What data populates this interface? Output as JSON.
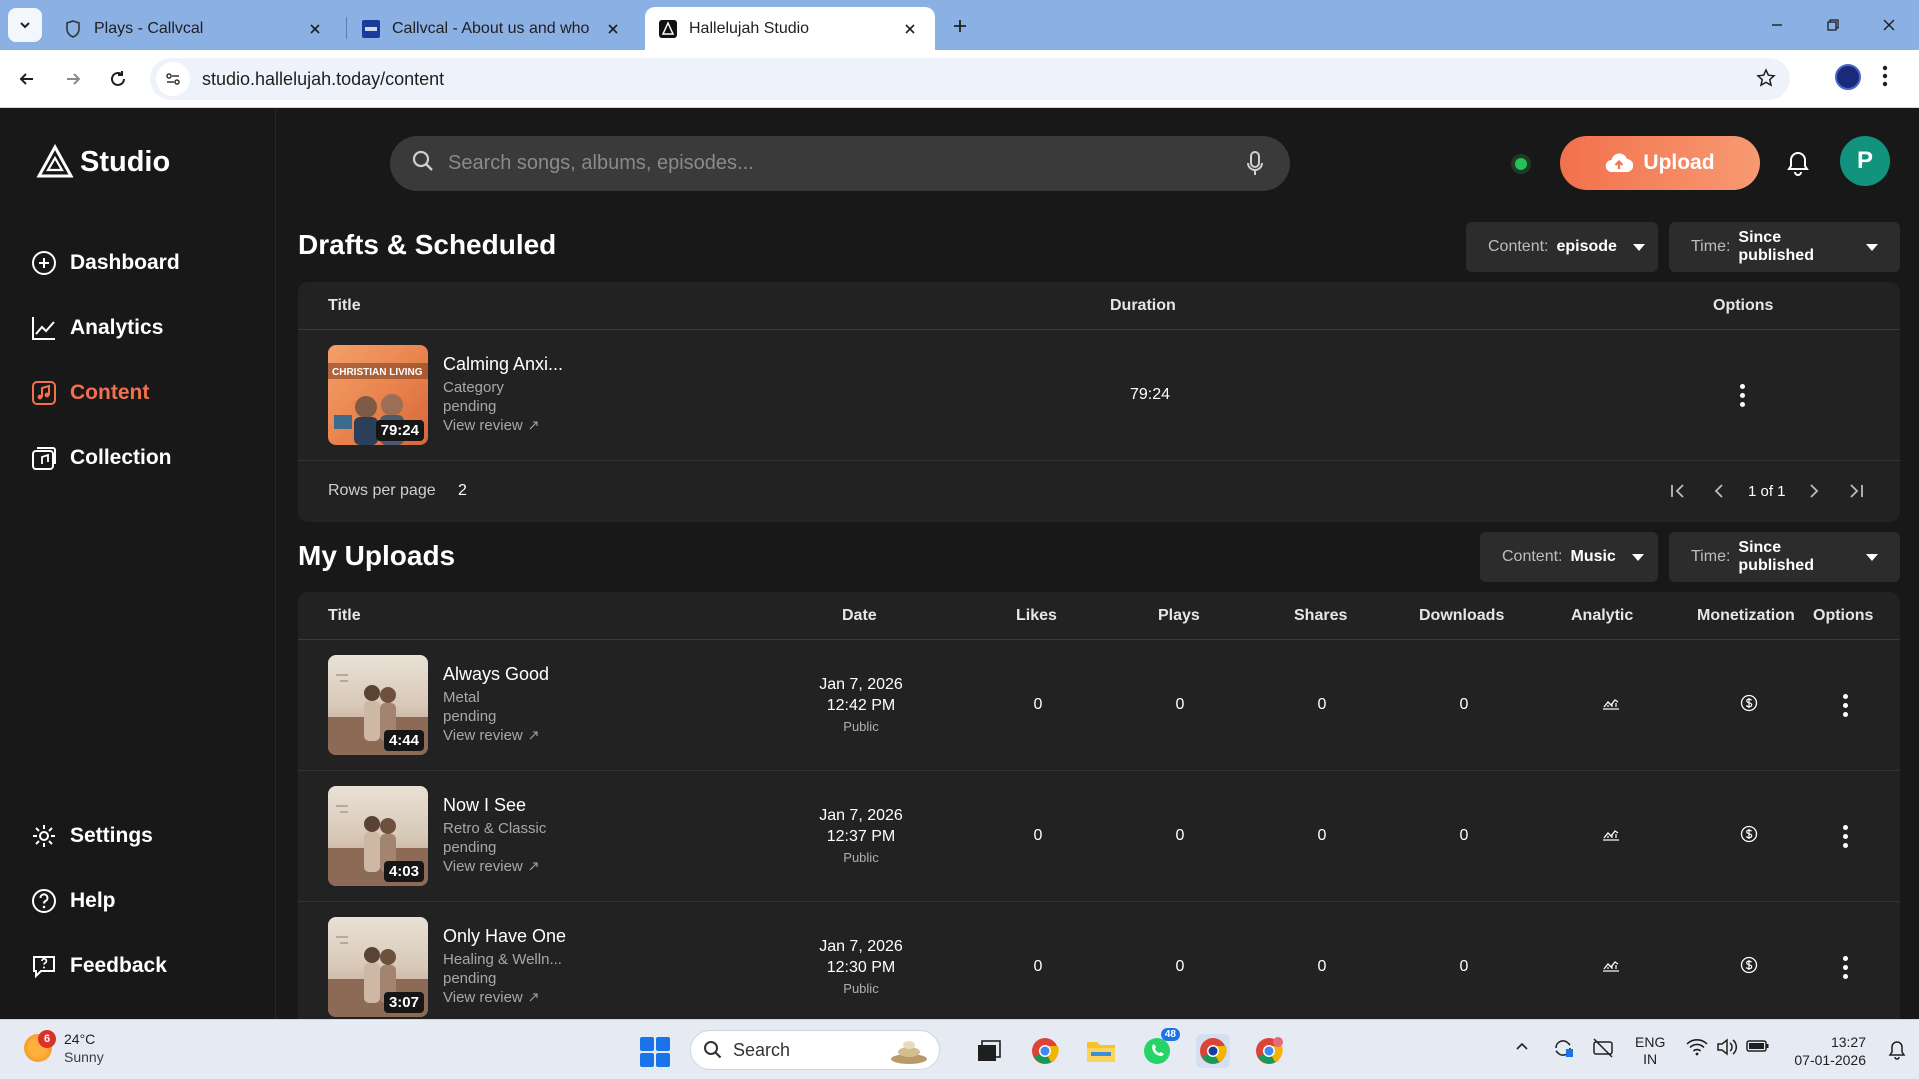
{
  "browser": {
    "tabs": [
      {
        "title": "Plays - Callvcal"
      },
      {
        "title": "Callvcal - About us and who we are"
      },
      {
        "title": "Hallelujah Studio"
      }
    ],
    "url": "studio.hallelujah.today/content"
  },
  "app": {
    "brand": "Studio",
    "nav": {
      "dashboard": "Dashboard",
      "analytics": "Analytics",
      "content": "Content",
      "collection": "Collection",
      "settings": "Settings",
      "help": "Help",
      "feedback": "Feedback"
    },
    "search_placeholder": "Search songs, albums, episodes...",
    "upload_label": "Upload",
    "avatar_letter": "P",
    "accent_color": "#f2704d"
  },
  "drafts": {
    "title": "Drafts & Scheduled",
    "filter_content_label": "Content:",
    "filter_content_value": "episode",
    "filter_time_label": "Time:",
    "filter_time_value": "Since published",
    "headers": {
      "title": "Title",
      "duration": "Duration",
      "options": "Options"
    },
    "rows": [
      {
        "title": "Calming Anxi...",
        "category": "Category",
        "status": "pending",
        "link": "View review",
        "duration": "79:24",
        "badge": "79:24",
        "art_text": "CHRISTIAN LIVING"
      }
    ],
    "rows_per_page_label": "Rows per page",
    "rows_per_page": "2",
    "page_info": "1 of 1"
  },
  "uploads": {
    "title": "My Uploads",
    "filter_content_label": "Content:",
    "filter_content_value": "Music",
    "filter_time_label": "Time:",
    "filter_time_value": "Since published",
    "headers": {
      "title": "Title",
      "date": "Date",
      "likes": "Likes",
      "plays": "Plays",
      "shares": "Shares",
      "downloads": "Downloads",
      "analytic": "Analytic",
      "monetization": "Monetization",
      "options": "Options"
    },
    "rows": [
      {
        "title": "Always Good",
        "genre": "Metal",
        "status": "pending",
        "link": "View review",
        "badge": "4:44",
        "date": "Jan 7, 2026",
        "time": "12:42 PM",
        "visibility": "Public",
        "likes": "0",
        "plays": "0",
        "shares": "0",
        "downloads": "0"
      },
      {
        "title": "Now I See",
        "genre": "Retro & Classic",
        "status": "pending",
        "link": "View review",
        "badge": "4:03",
        "date": "Jan 7, 2026",
        "time": "12:37 PM",
        "visibility": "Public",
        "likes": "0",
        "plays": "0",
        "shares": "0",
        "downloads": "0"
      },
      {
        "title": "Only Have One",
        "genre": "Healing & Welln...",
        "status": "pending",
        "link": "View review",
        "badge": "3:07",
        "date": "Jan 7, 2026",
        "time": "12:30 PM",
        "visibility": "Public",
        "likes": "0",
        "plays": "0",
        "shares": "0",
        "downloads": "0"
      }
    ]
  },
  "taskbar": {
    "weather_temp": "24°C",
    "weather_desc": "Sunny",
    "weather_badge": "6",
    "search_label": "Search",
    "whatsapp_badge": "48",
    "lang_1": "ENG",
    "lang_2": "IN",
    "time": "13:27",
    "date": "07-01-2026"
  }
}
